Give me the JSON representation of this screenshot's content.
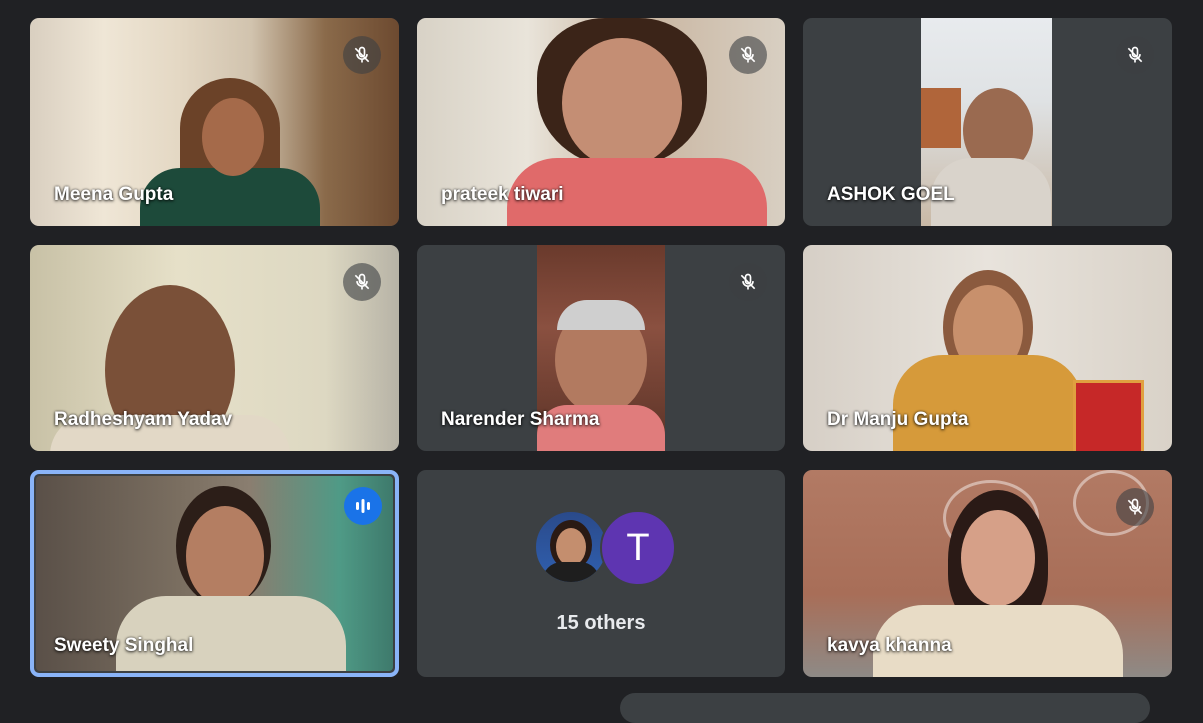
{
  "participants": [
    {
      "name": "Meena Gupta",
      "muted": true
    },
    {
      "name": "prateek tiwari",
      "muted": true
    },
    {
      "name": "ASHOK GOEL",
      "muted": true
    },
    {
      "name": "Radheshyam Yadav",
      "muted": true
    },
    {
      "name": "Narender Sharma",
      "muted": true
    },
    {
      "name": "Dr Manju Gupta",
      "muted": false
    },
    {
      "name": "Sweety Singhal",
      "speaking": true
    },
    {
      "name": "kavya khanna",
      "muted": true
    }
  ],
  "others": {
    "avatar_letter": "T",
    "label": "15 others"
  },
  "colors": {
    "background": "#202124",
    "tile": "#3c4043",
    "active_speaker_border": "#8ab4f8",
    "speaking_indicator": "#1a73e8",
    "others_avatar": "#5e35b1"
  },
  "icons": {
    "muted": "mic-off-icon",
    "speaking": "audio-levels-icon"
  }
}
